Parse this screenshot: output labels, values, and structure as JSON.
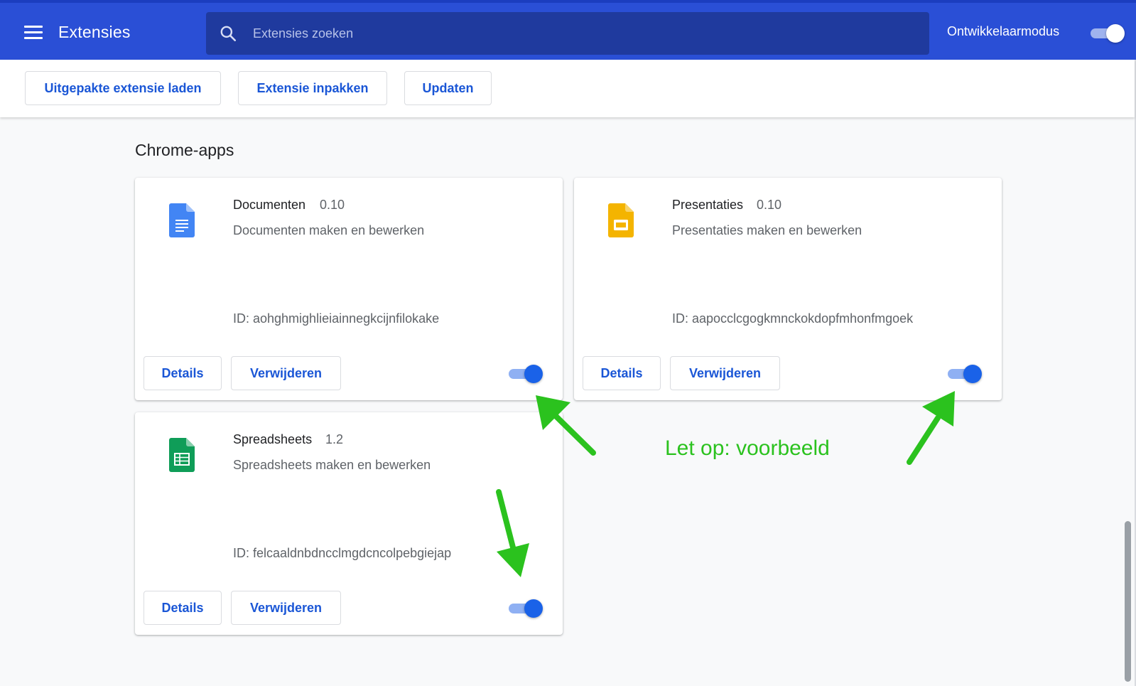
{
  "header": {
    "title": "Extensies",
    "search_placeholder": "Extensies zoeken",
    "dev_mode_label": "Ontwikkelaarmodus",
    "dev_mode_on": true
  },
  "toolbar": {
    "load_unpacked": "Uitgepakte extensie laden",
    "pack_extension": "Extensie inpakken",
    "update": "Updaten"
  },
  "section": {
    "title": "Chrome-apps"
  },
  "apps": [
    {
      "name": "Documenten",
      "version": "0.10",
      "description": "Documenten maken en bewerken",
      "id_text": "ID: aohghmighlieiainnegkcijnfilokake",
      "details_label": "Details",
      "remove_label": "Verwijderen",
      "enabled": true,
      "icon": "docs-icon",
      "icon_color": "#4285f4"
    },
    {
      "name": "Presentaties",
      "version": "0.10",
      "description": "Presentaties maken en bewerken",
      "id_text": "ID: aapocclcgogkmnckokdopfmhonfmgoek",
      "details_label": "Details",
      "remove_label": "Verwijderen",
      "enabled": true,
      "icon": "slides-icon",
      "icon_color": "#f4b400"
    },
    {
      "name": "Spreadsheets",
      "version": "1.2",
      "description": "Spreadsheets maken en bewerken",
      "id_text": "ID: felcaaldnbdncclmgdcncolpebgiejap",
      "details_label": "Details",
      "remove_label": "Verwijderen",
      "enabled": true,
      "icon": "sheets-icon",
      "icon_color": "#0f9d58"
    }
  ],
  "annotation": {
    "text": "Let op: voorbeeld",
    "color": "#2bc21e"
  },
  "colors": {
    "header_bg": "#2a4fd6",
    "accent": "#1a56d6",
    "toggle_on": "#1a62e8"
  }
}
